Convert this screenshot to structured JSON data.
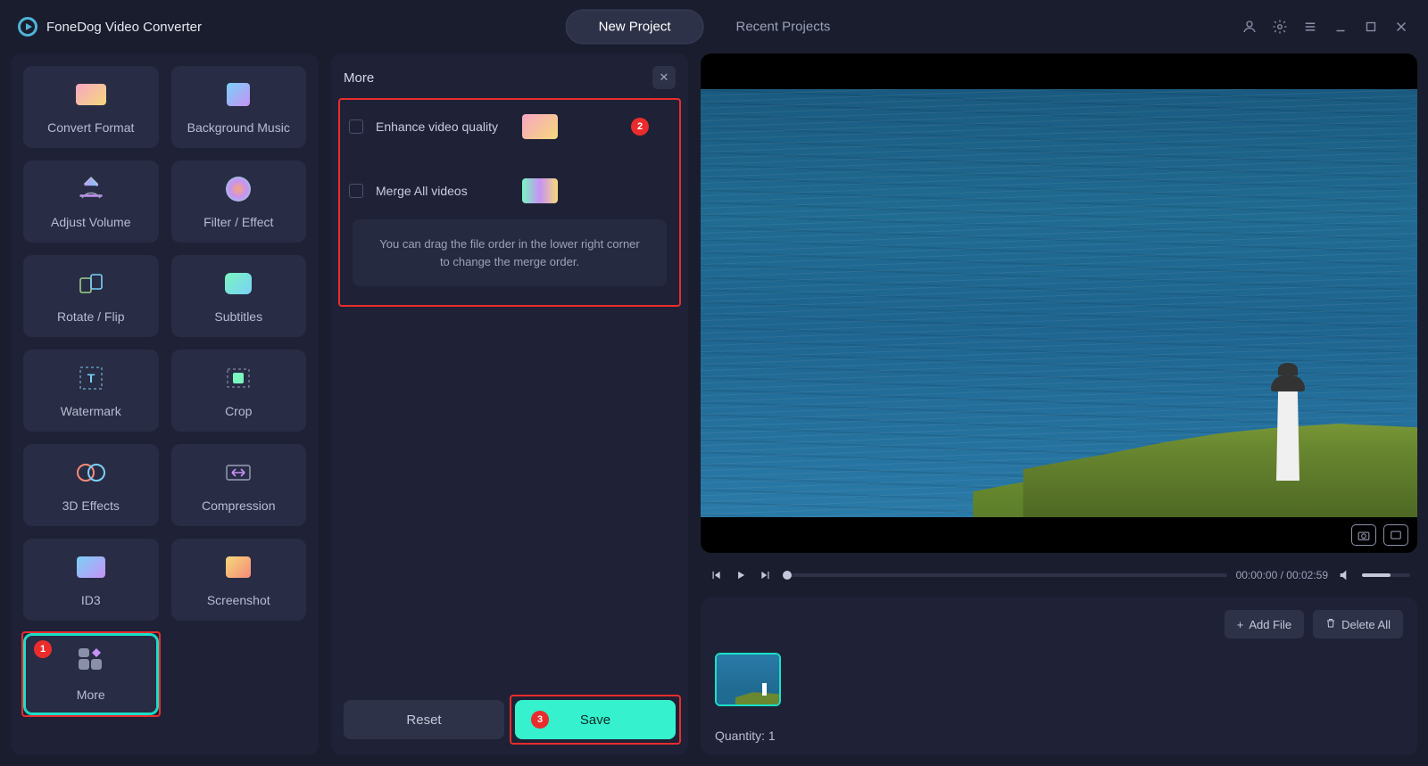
{
  "app": {
    "title": "FoneDog Video Converter"
  },
  "tabs": {
    "new_project": "New Project",
    "recent_projects": "Recent Projects"
  },
  "tools": [
    {
      "id": "convert-format",
      "label": "Convert Format"
    },
    {
      "id": "background-music",
      "label": "Background Music"
    },
    {
      "id": "adjust-volume",
      "label": "Adjust Volume"
    },
    {
      "id": "filter-effect",
      "label": "Filter / Effect"
    },
    {
      "id": "rotate-flip",
      "label": "Rotate / Flip"
    },
    {
      "id": "subtitles",
      "label": "Subtitles"
    },
    {
      "id": "watermark",
      "label": "Watermark"
    },
    {
      "id": "crop",
      "label": "Crop"
    },
    {
      "id": "3d-effects",
      "label": "3D Effects"
    },
    {
      "id": "compression",
      "label": "Compression"
    },
    {
      "id": "id3",
      "label": "ID3"
    },
    {
      "id": "screenshot",
      "label": "Screenshot"
    },
    {
      "id": "more",
      "label": "More"
    }
  ],
  "more_panel": {
    "title": "More",
    "enhance_label": "Enhance video quality",
    "merge_label": "Merge All videos",
    "tip": "You can drag the file order in the lower right corner to change the merge order.",
    "reset": "Reset",
    "save": "Save"
  },
  "callouts": {
    "one": "1",
    "two": "2",
    "three": "3"
  },
  "playback": {
    "time": "00:00:00 / 00:02:59"
  },
  "filebar": {
    "add_file": "Add File",
    "delete_all": "Delete All",
    "quantity_label": "Quantity: 1"
  }
}
